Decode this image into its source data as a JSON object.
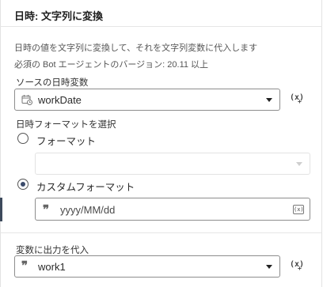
{
  "title": "日時: 文字列に変換",
  "description": {
    "line1": "日時の値を文字列に変換して、それを文字列変数に代入します",
    "line2": "必須の Bot エージェントのバージョン: 20.11 以上"
  },
  "source": {
    "label": "ソースの日時変数",
    "value": "workDate",
    "icon": "calendar-clock-icon",
    "var_button": "(x)"
  },
  "format": {
    "label": "日時フォーマットを選択",
    "options": [
      {
        "label": "フォーマット",
        "checked": false
      },
      {
        "label": "カスタムフォーマット",
        "checked": true
      }
    ],
    "custom_value": "yyyy/MM/dd",
    "insert_icon": "(x)"
  },
  "output": {
    "label": "変数に出力を代入",
    "value": "work1",
    "icon": "string-quote-icon",
    "var_button": "(x)"
  },
  "colors": {
    "accent": "#3b4b6b",
    "border": "#8d8d8d"
  }
}
